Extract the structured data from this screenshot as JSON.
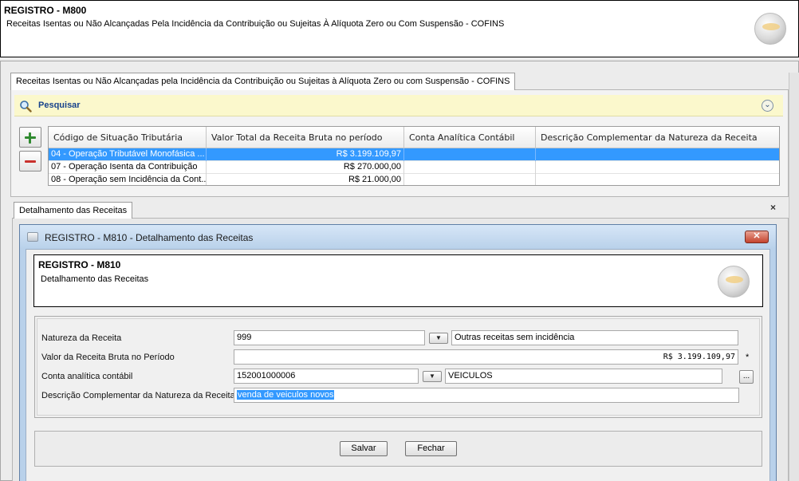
{
  "header": {
    "title": "REGISTRO - M800",
    "subtitle": "Receitas Isentas ou Não Alcançadas Pela Incidência da Contribuição ou Sujeitas À Alíquota Zero ou Com Suspensão - COFINS"
  },
  "top_tab": {
    "label": "Receitas Isentas ou Não Alcançadas pela Incidência da Contribuição ou Sujeitas à Alíquota Zero ou com Suspensão - COFINS"
  },
  "search": {
    "label": "Pesquisar",
    "collapse_glyph": "⌄",
    "icon": "search-icon"
  },
  "grid": {
    "columns": [
      "Código de Situação Tributária",
      "Valor Total da Receita Bruta no período",
      "Conta Analítica Contábil",
      "Descrição Complementar da Natureza da Receita"
    ],
    "rows": [
      {
        "cst": "04 - Operação Tributável Monofásica ...",
        "valor": "R$ 3.199.109,97",
        "conta": "",
        "descricao": "",
        "selected": true
      },
      {
        "cst": "07 - Operação Isenta da Contribuição",
        "valor": "R$ 270.000,00",
        "conta": "",
        "descricao": "",
        "selected": false
      },
      {
        "cst": "08 - Operação sem Incidência da Cont...",
        "valor": "R$ 21.000,00",
        "conta": "",
        "descricao": "",
        "selected": false
      }
    ]
  },
  "bottom_tab": {
    "label": "Detalhamento das Receitas",
    "close_glyph": "×"
  },
  "dialog": {
    "title": "REGISTRO - M810 - Detalhamento das Receitas",
    "close_glyph": "✕",
    "header": {
      "title": "REGISTRO - M810",
      "subtitle": "Detalhamento das Receitas"
    },
    "form": {
      "natureza_label": "Natureza da Receita",
      "natureza_value": "999",
      "natureza_desc": "Outras receitas sem incidência",
      "valor_label": "Valor da Receita Bruta no Período",
      "valor_value": "R$ 3.199.109,97",
      "required_mark": "*",
      "conta_label": "Conta analítica contábil",
      "conta_value": "152001000006",
      "conta_desc": "VEICULOS",
      "ellipsis_label": "...",
      "descricao_label": "Descrição Complementar da Natureza da Receita",
      "descricao_value": "venda de veiculos novos",
      "dropdown_glyph": "▼"
    },
    "buttons": {
      "save": "Salvar",
      "close": "Fechar"
    }
  }
}
